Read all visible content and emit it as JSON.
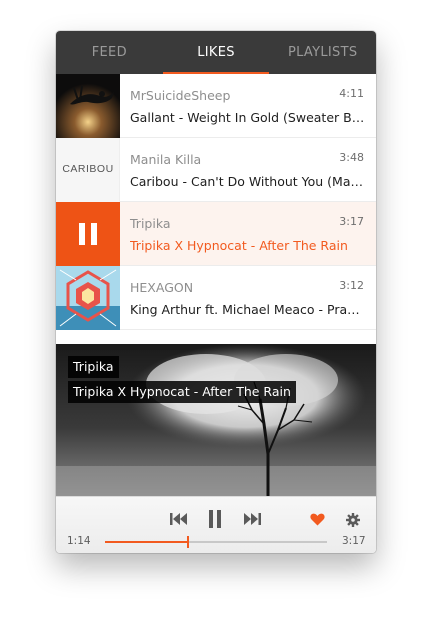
{
  "tabs": [
    {
      "label": "FEED",
      "active": false
    },
    {
      "label": "LIKES",
      "active": true
    },
    {
      "label": "PLAYLISTS",
      "active": false
    }
  ],
  "tracks": [
    {
      "artist": "MrSuicideSheep",
      "duration": "4:11",
      "title": "Gallant - Weight In Gold (Sweater Beats Remix)",
      "art": "dark-floating-figure"
    },
    {
      "artist": "Manila Killa",
      "duration": "3:48",
      "title": "Caribou - Can't Do Without You (Manila Killa Remix)",
      "art": "caribou-logo",
      "art_text": "CARIBOU"
    },
    {
      "artist": "Tripika",
      "duration": "3:17",
      "title": "Tripika X Hypnocat - After The Rain",
      "art": "pause-overlay",
      "playing": true
    },
    {
      "artist": "HEXAGON",
      "duration": "3:12",
      "title": "King Arthur ft. Michael Meaco - Prayer",
      "art": "hexagon-geometric"
    }
  ],
  "now_playing": {
    "artist": "Tripika",
    "title": "Tripika X Hypnocat - After The Rain",
    "elapsed": "1:14",
    "total": "3:17",
    "progress": 0.376,
    "liked": true
  },
  "icons": {
    "previous": "skip-back-icon",
    "pause": "pause-icon",
    "next": "skip-forward-icon",
    "like": "heart-icon",
    "settings": "gear-icon"
  },
  "colors": {
    "accent": "#f25a1f",
    "tabbar": "#3a3a3a",
    "playing_row": "#fdf3ee"
  }
}
